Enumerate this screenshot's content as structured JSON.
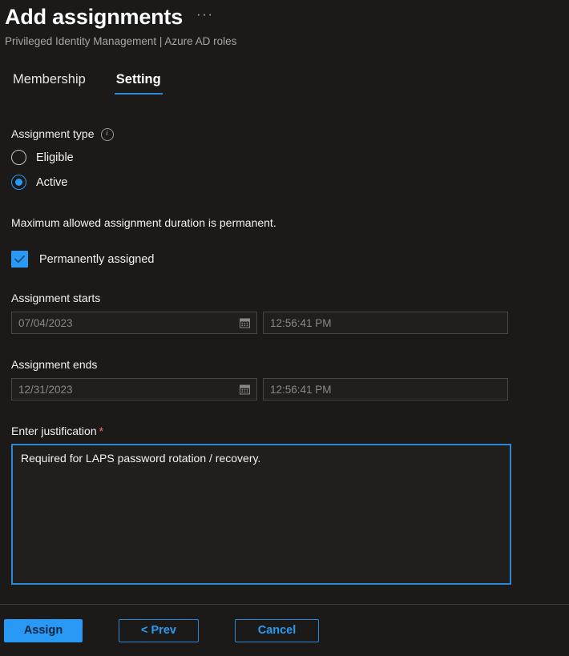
{
  "header": {
    "title": "Add assignments",
    "more_menu": "···",
    "breadcrumb": "Privileged Identity Management | Azure AD roles"
  },
  "tabs": [
    {
      "label": "Membership",
      "active": false
    },
    {
      "label": "Setting",
      "active": true
    }
  ],
  "assignment_type": {
    "label": "Assignment type",
    "info_glyph": "i",
    "options": [
      {
        "label": "Eligible",
        "selected": false
      },
      {
        "label": "Active",
        "selected": true
      }
    ]
  },
  "duration_note": "Maximum allowed assignment duration is permanent.",
  "permanent": {
    "label": "Permanently assigned",
    "checked": true
  },
  "assignment_starts": {
    "label": "Assignment starts",
    "date_value": "07/04/2023",
    "time_value": "12:56:41 PM"
  },
  "assignment_ends": {
    "label": "Assignment ends",
    "date_value": "12/31/2023",
    "time_value": "12:56:41 PM"
  },
  "justification": {
    "label": "Enter justification",
    "required_marker": "*",
    "value": "Required for LAPS password rotation / recovery."
  },
  "footer": {
    "assign_label": "Assign",
    "prev_label": "< Prev",
    "cancel_label": "Cancel"
  },
  "colors": {
    "background": "#1b1a19",
    "accent": "#2899f5",
    "tab_underline": "#2b88d8",
    "focus_border": "#2b88d8",
    "required_star": "#f1707b",
    "muted_text": "#8a8886"
  }
}
